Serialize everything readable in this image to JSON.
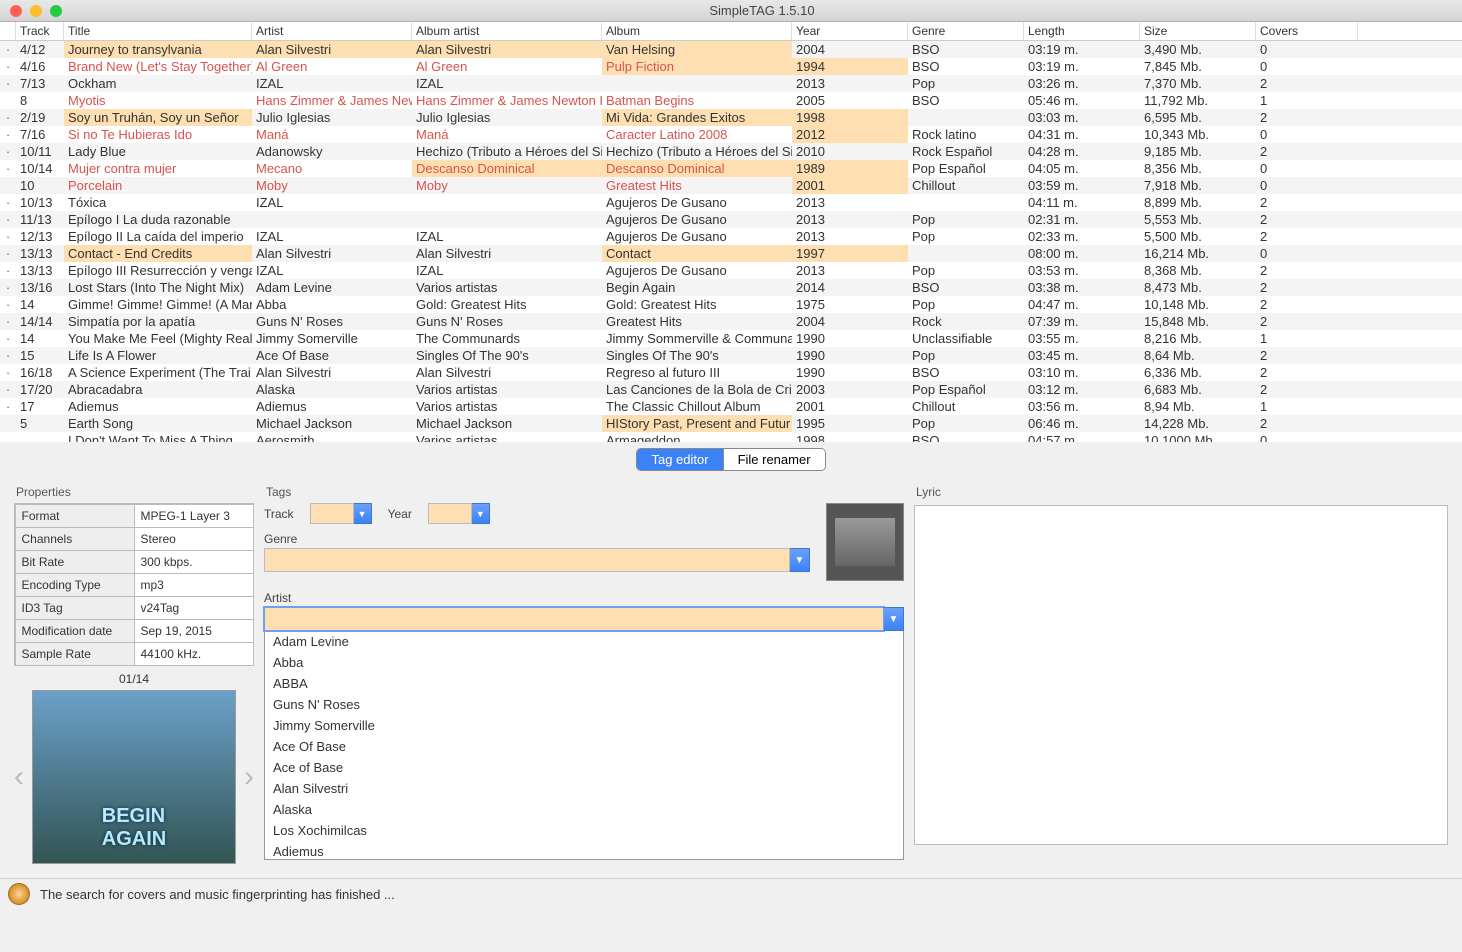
{
  "window": {
    "title": "SimpleTAG 1.5.10"
  },
  "columns": [
    "",
    "Track",
    "Title",
    "Artist",
    "Album artist",
    "Album",
    "Year",
    "Genre",
    "Length",
    "Size",
    "Covers"
  ],
  "rows": [
    {
      "dot": "·",
      "track": "4/12",
      "title": "Journey to transylvania",
      "artist": "Alan Silvestri",
      "albumartist": "Alan Silvestri",
      "album": "Van Helsing",
      "year": "2004",
      "genre": "BSO",
      "length": "03:19 m.",
      "size": "3,490 Mb.",
      "covers": "0",
      "hl": [
        "title",
        "artist",
        "albumartist",
        "album"
      ],
      "red": false
    },
    {
      "dot": "·",
      "track": "4/16",
      "title": "Brand New (Let's Stay Together)",
      "artist": "Al Green",
      "albumartist": "Al Green",
      "album": "Pulp Fiction",
      "year": "1994",
      "genre": "BSO",
      "length": "03:19 m.",
      "size": "7,845 Mb.",
      "covers": "0",
      "hl": [
        "album",
        "year"
      ],
      "red": true
    },
    {
      "dot": "·",
      "track": "7/13",
      "title": "Ockham",
      "artist": "IZAL",
      "albumartist": "IZAL",
      "album": "",
      "year": "2013",
      "genre": "Pop",
      "length": "03:26 m.",
      "size": "7,370 Mb.",
      "covers": "2",
      "hl": [],
      "red": false
    },
    {
      "dot": "",
      "track": "8",
      "title": "Myotis",
      "artist": "Hans Zimmer & James New",
      "albumartist": "Hans Zimmer & James Newton H",
      "album": "Batman Begins",
      "year": "2005",
      "genre": "BSO",
      "length": "05:46 m.",
      "size": "11,792 Mb.",
      "covers": "1",
      "hl": [],
      "red": true
    },
    {
      "dot": "·",
      "track": "2/19",
      "title": "Soy un Truhán, Soy un Señor",
      "artist": "Julio Iglesias",
      "albumartist": "Julio Iglesias",
      "album": "Mi Vida: Grandes Exitos",
      "year": "1998",
      "genre": "",
      "length": "03:03 m.",
      "size": "6,595 Mb.",
      "covers": "2",
      "hl": [
        "title",
        "album",
        "year"
      ],
      "red": false
    },
    {
      "dot": "·",
      "track": "7/16",
      "title": "Si no Te Hubieras Ido",
      "artist": "Maná",
      "albumartist": "Maná",
      "album": "Caracter Latino 2008",
      "year": "2012",
      "genre": "Rock latino",
      "length": "04:31 m.",
      "size": "10,343 Mb.",
      "covers": "0",
      "hl": [
        "year"
      ],
      "red": true
    },
    {
      "dot": "·",
      "track": "10/11",
      "title": "Lady Blue",
      "artist": "Adanowsky",
      "albumartist": "Hechizo (Tributo a Héroes del Si",
      "album": "Hechizo (Tributo a Héroes del Si",
      "year": "2010",
      "genre": "Rock Español",
      "length": "04:28 m.",
      "size": "9,185 Mb.",
      "covers": "2",
      "hl": [],
      "red": false
    },
    {
      "dot": "·",
      "track": "10/14",
      "title": "Mujer contra mujer",
      "artist": "Mecano",
      "albumartist": "Descanso Dominical",
      "album": "Descanso Dominical",
      "year": "1989",
      "genre": "Pop Español",
      "length": "04:05 m.",
      "size": "8,356 Mb.",
      "covers": "0",
      "hl": [
        "albumartist",
        "album",
        "year"
      ],
      "red": true
    },
    {
      "dot": "",
      "track": "10",
      "title": "Porcelain",
      "artist": "Moby",
      "albumartist": "Moby",
      "album": "Greatest Hits",
      "year": "2001",
      "genre": "Chillout",
      "length": "03:59 m.",
      "size": "7,918 Mb.",
      "covers": "0",
      "hl": [
        "year"
      ],
      "red": true
    },
    {
      "dot": "·",
      "track": "10/13",
      "title": "Tóxica",
      "artist": "IZAL",
      "albumartist": "",
      "album": "Agujeros De Gusano",
      "year": "2013",
      "genre": "",
      "length": "04:11 m.",
      "size": "8,899 Mb.",
      "covers": "2",
      "hl": [],
      "red": false
    },
    {
      "dot": "·",
      "track": "11/13",
      "title": "Epílogo I La duda razonable",
      "artist": "",
      "albumartist": "",
      "album": "Agujeros De Gusano",
      "year": "2013",
      "genre": "Pop",
      "length": "02:31 m.",
      "size": "5,553 Mb.",
      "covers": "2",
      "hl": [],
      "red": false
    },
    {
      "dot": "·",
      "track": "12/13",
      "title": "Epílogo II La caída del imperio",
      "artist": "IZAL",
      "albumartist": "IZAL",
      "album": "Agujeros De Gusano",
      "year": "2013",
      "genre": "Pop",
      "length": "02:33 m.",
      "size": "5,500 Mb.",
      "covers": "2",
      "hl": [],
      "red": false
    },
    {
      "dot": "·",
      "track": "13/13",
      "title": "Contact - End Credits",
      "artist": "Alan Silvestri",
      "albumartist": "Alan Silvestri",
      "album": "Contact",
      "year": "1997",
      "genre": "",
      "length": "08:00 m.",
      "size": "16,214 Mb.",
      "covers": "0",
      "hl": [
        "title",
        "album",
        "year"
      ],
      "red": false
    },
    {
      "dot": "·",
      "track": "13/13",
      "title": "Epílogo III Resurrección y venga",
      "artist": "IZAL",
      "albumartist": "IZAL",
      "album": "Agujeros De Gusano",
      "year": "2013",
      "genre": "Pop",
      "length": "03:53 m.",
      "size": "8,368 Mb.",
      "covers": "2",
      "hl": [],
      "red": false
    },
    {
      "dot": "·",
      "track": "13/16",
      "title": "Lost Stars (Into The Night Mix)",
      "artist": "Adam Levine",
      "albumartist": "Varios artistas",
      "album": "Begin Again",
      "year": "2014",
      "genre": "BSO",
      "length": "03:38 m.",
      "size": "8,473 Mb.",
      "covers": "2",
      "hl": [],
      "red": false
    },
    {
      "dot": "·",
      "track": "14",
      "title": "Gimme! Gimme! Gimme! (A Man",
      "artist": "Abba",
      "albumartist": "Gold: Greatest Hits",
      "album": "Gold: Greatest Hits",
      "year": "1975",
      "genre": "Pop",
      "length": "04:47 m.",
      "size": "10,148 Mb.",
      "covers": "2",
      "hl": [],
      "red": false
    },
    {
      "dot": "·",
      "track": "14/14",
      "title": "Simpatía por la apatía",
      "artist": "Guns N' Roses",
      "albumartist": "Guns N' Roses",
      "album": "Greatest Hits",
      "year": "2004",
      "genre": "Rock",
      "length": "07:39 m.",
      "size": "15,848 Mb.",
      "covers": "2",
      "hl": [],
      "red": false
    },
    {
      "dot": "·",
      "track": "14",
      "title": "You Make Me Feel (Mighty Real)",
      "artist": "Jimmy Somerville",
      "albumartist": "The Communards",
      "album": "Jimmy Sommerville & Communa",
      "year": "1990",
      "genre": "Unclassifiable",
      "length": "03:55 m.",
      "size": "8,216 Mb.",
      "covers": "1",
      "hl": [],
      "red": false
    },
    {
      "dot": "·",
      "track": "15",
      "title": "Life Is A Flower",
      "artist": "Ace Of Base",
      "albumartist": "Singles Of The 90's",
      "album": "Singles Of The 90's",
      "year": "1990",
      "genre": "Pop",
      "length": "03:45 m.",
      "size": "8,64 Mb.",
      "covers": "2",
      "hl": [],
      "red": false
    },
    {
      "dot": "·",
      "track": "16/18",
      "title": "A Science Experiment  (The Trai",
      "artist": "Alan Silvestri",
      "albumartist": "Alan Silvestri",
      "album": "Regreso al futuro III",
      "year": "1990",
      "genre": "BSO",
      "length": "03:10 m.",
      "size": "6,336 Mb.",
      "covers": "2",
      "hl": [],
      "red": false
    },
    {
      "dot": "·",
      "track": "17/20",
      "title": "Abracadabra",
      "artist": "Alaska",
      "albumartist": "Varios artistas",
      "album": "Las Canciones de la Bola de Cri",
      "year": "2003",
      "genre": "Pop Español",
      "length": "03:12 m.",
      "size": "6,683 Mb.",
      "covers": "2",
      "hl": [],
      "red": false
    },
    {
      "dot": "·",
      "track": "17",
      "title": "Adiemus",
      "artist": "Adiemus",
      "albumartist": "Varios artistas",
      "album": "The Classic Chillout Album",
      "year": "2001",
      "genre": "Chillout",
      "length": "03:56 m.",
      "size": "8,94 Mb.",
      "covers": "1",
      "hl": [],
      "red": false
    },
    {
      "dot": "",
      "track": "5",
      "title": "Earth Song",
      "artist": "Michael Jackson",
      "albumartist": "Michael Jackson",
      "album": "HIStory Past, Present and Futur",
      "year": "1995",
      "genre": "Pop",
      "length": "06:46 m.",
      "size": "14,228 Mb.",
      "covers": "2",
      "hl": [
        "album"
      ],
      "red": false
    },
    {
      "dot": "",
      "track": "",
      "title": "I Don't Want To Miss A Thing",
      "artist": "Aerosmith",
      "albumartist": "Varios artistas",
      "album": "Armageddon",
      "year": "1998",
      "genre": "BSO",
      "length": "04:57 m.",
      "size": "10,1000 Mb.",
      "covers": "0",
      "hl": [],
      "red": false
    }
  ],
  "tabs": {
    "tag_editor": "Tag editor",
    "file_renamer": "File renamer"
  },
  "properties": {
    "title": "Properties",
    "items": [
      {
        "k": "Format",
        "v": "MPEG-1 Layer 3"
      },
      {
        "k": "Channels",
        "v": "Stereo"
      },
      {
        "k": "Bit Rate",
        "v": "300 kbps."
      },
      {
        "k": "Encoding Type",
        "v": "mp3"
      },
      {
        "k": "ID3 Tag",
        "v": "v24Tag"
      },
      {
        "k": "Modification date",
        "v": "Sep 19, 2015"
      },
      {
        "k": "Sample Rate",
        "v": "44100 kHz."
      }
    ],
    "cover_counter": "01/14",
    "cover_caption": "BEGIN\nAGAIN"
  },
  "tags": {
    "title": "Tags",
    "track_label": "Track",
    "year_label": "Year",
    "genre_label": "Genre",
    "artist_label": "Artist",
    "track_value": "",
    "year_value": "",
    "genre_value": "",
    "artist_value": "",
    "artist_options": [
      "Adam Levine",
      "Abba",
      "ABBA",
      "Guns N' Roses",
      "Jimmy Somerville",
      "Ace Of Base",
      "Ace of Base",
      "Alan Silvestri",
      "Alaska",
      "Los Xochimilcas",
      "Adiemus"
    ]
  },
  "lyric": {
    "title": "Lyric"
  },
  "status": {
    "text": "The search for covers and music fingerprinting has finished ..."
  }
}
